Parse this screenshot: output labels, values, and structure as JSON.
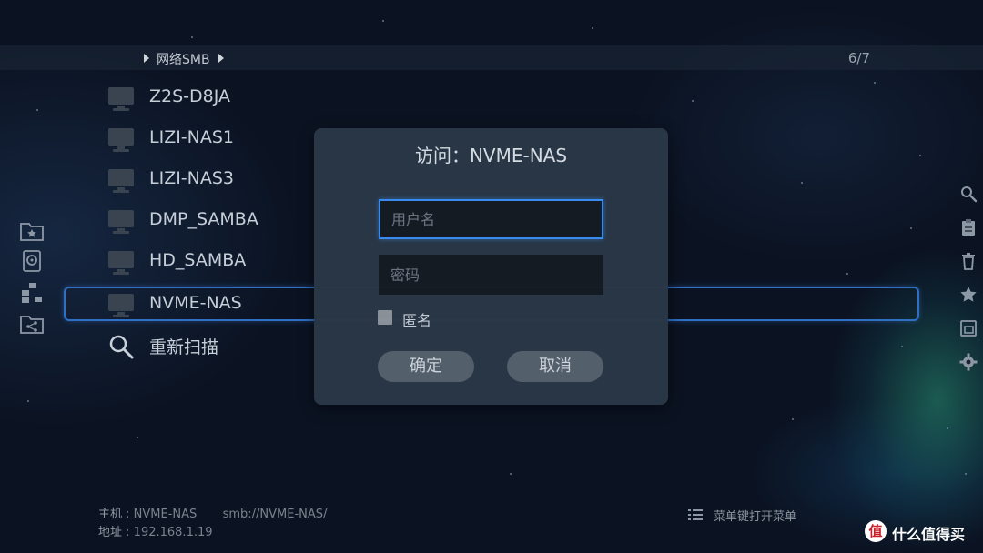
{
  "breadcrumb": {
    "items": [
      "网络SMB"
    ],
    "pager": "6/7"
  },
  "servers": [
    {
      "label": "Z2S-D8JA",
      "icon": "monitor-icon"
    },
    {
      "label": "LIZI-NAS1",
      "icon": "monitor-icon"
    },
    {
      "label": "LIZI-NAS3",
      "icon": "monitor-icon"
    },
    {
      "label": "DMP_SAMBA",
      "icon": "monitor-icon"
    },
    {
      "label": "HD_SAMBA",
      "icon": "monitor-icon"
    },
    {
      "label": "NVME-NAS",
      "icon": "monitor-icon",
      "selected": true
    }
  ],
  "rescan": {
    "label": "重新扫描",
    "icon": "search-icon"
  },
  "dialog": {
    "title": "访问：NVME-NAS",
    "username_placeholder": "用户名",
    "password_placeholder": "密码",
    "anonymous_label": "匿名",
    "anonymous_checked": false,
    "ok_label": "确定",
    "cancel_label": "取消"
  },
  "info": {
    "host_label": "主机",
    "host_value": "NVME-NAS",
    "smb_path": "smb://NVME-NAS/",
    "address_label": "地址",
    "address_value": "192.168.1.19"
  },
  "menu_hint": "菜单键打开菜单",
  "watermark": {
    "logo": "值",
    "text": "什么值得买"
  },
  "left_sidebar_icons": [
    "favorite-folder-icon",
    "disk-icon",
    "network-icon",
    "share-folder-icon"
  ],
  "right_sidebar_icons": [
    "search-icon",
    "clipboard-icon",
    "trash-icon",
    "star-icon",
    "window-icon",
    "gear-icon"
  ],
  "colors": {
    "accent": "#3a8ef2",
    "selection_border": "#2f6fc4",
    "dialog_bg": "#2a3746",
    "button_bg": "#56616e"
  }
}
